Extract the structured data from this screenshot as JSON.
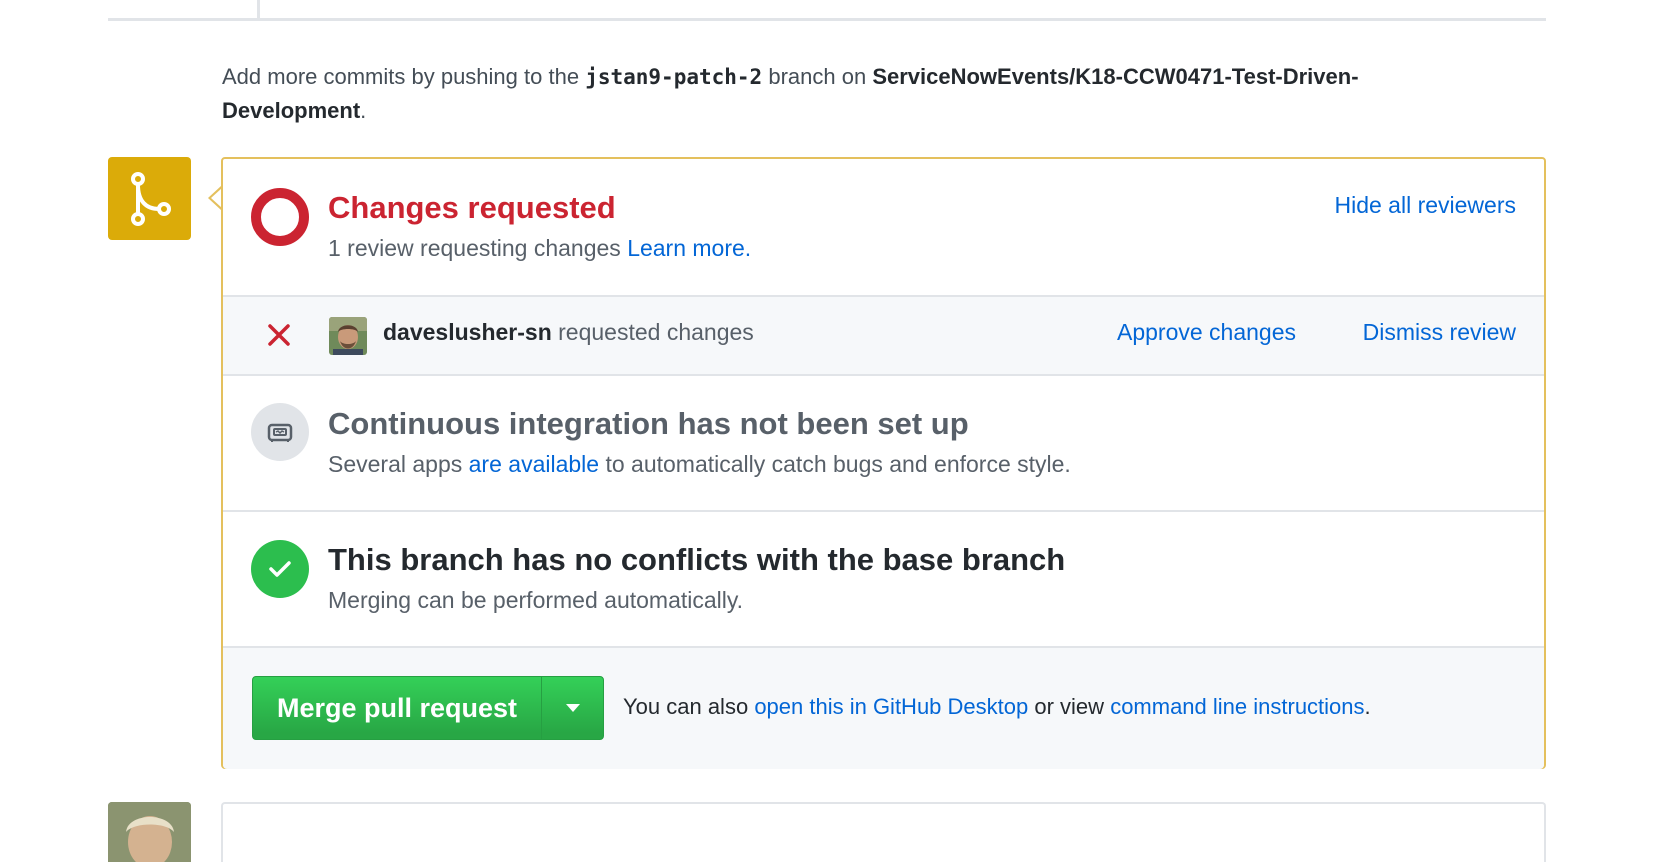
{
  "push_note": {
    "prefix": "Add more commits by pushing to the",
    "branch": "jstan9-patch-2",
    "middle": "branch on",
    "repo": "ServiceNowEvents/K18-CCW0471-Test-Driven-Development",
    "suffix": "."
  },
  "status": {
    "title": "Changes requested",
    "subtitle": "1 review requesting changes",
    "learn_more": "Learn more.",
    "hide_reviewers": "Hide all reviewers"
  },
  "review": {
    "user": "daveslusher-sn",
    "action": "requested changes",
    "approve": "Approve changes",
    "dismiss": "Dismiss review"
  },
  "ci": {
    "title": "Continuous integration has not been set up",
    "sub_prefix": "Several apps",
    "sub_link": "are available",
    "sub_suffix": "to automatically catch bugs and enforce style."
  },
  "conflicts": {
    "title": "This branch has no conflicts with the base branch",
    "subtitle": "Merging can be performed automatically."
  },
  "merge": {
    "button": "Merge pull request",
    "text_prefix": "You can also",
    "desktop_link": "open this in GitHub Desktop",
    "text_middle": "or view",
    "cli_link": "command line instructions",
    "text_suffix": "."
  },
  "colors": {
    "merge_badge": "#dbab09",
    "danger": "#cb2431",
    "success": "#2cbe4e",
    "link": "#0366d6"
  },
  "icons": [
    "git-merge-icon",
    "changes-requested-icon",
    "x-icon",
    "ci-icon",
    "check-icon",
    "triangle-down-icon"
  ]
}
